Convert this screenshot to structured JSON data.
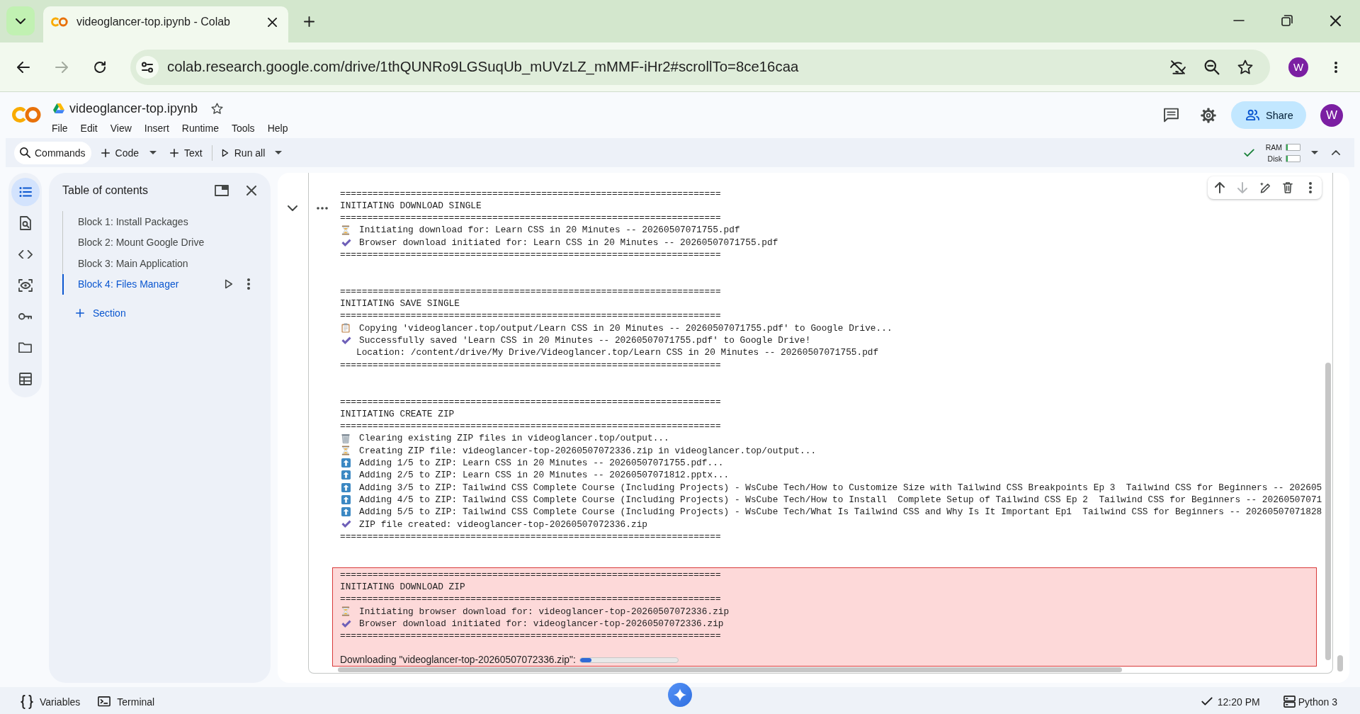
{
  "browser": {
    "tab_title": "videoglancer-top.ipynb - Colab",
    "url": "colab.research.google.com/drive/1thQUNRo9LGSuqUb_mUVzLZ_mMMF-iHr2#scrollTo=8ce16caa",
    "profile_initial": "W"
  },
  "header": {
    "notebook_title": "videoglancer-top.ipynb",
    "menu": [
      "File",
      "Edit",
      "View",
      "Insert",
      "Runtime",
      "Tools",
      "Help"
    ],
    "share_label": "Share",
    "avatar_initial": "W"
  },
  "toolbar": {
    "commands": "Commands",
    "add_code": "Code",
    "add_text": "Text",
    "run_all": "Run all",
    "resources": [
      {
        "label": "RAM",
        "level": 0.08
      },
      {
        "label": "Disk",
        "level": 0.08
      }
    ]
  },
  "sidebar": {
    "items": [
      {
        "kind": "contents",
        "selected": true
      },
      {
        "kind": "find",
        "selected": false
      },
      {
        "kind": "snippets",
        "selected": false
      },
      {
        "kind": "inspect",
        "selected": false
      },
      {
        "kind": "secrets",
        "selected": false
      },
      {
        "kind": "files",
        "selected": false
      },
      {
        "kind": "data",
        "selected": false
      }
    ]
  },
  "table_of_contents": {
    "title": "Table of contents",
    "items": [
      {
        "label": "Block 1: Install Packages",
        "selected": false
      },
      {
        "label": "Block 2: Mount Google Drive",
        "selected": false
      },
      {
        "label": "Block 3: Main Application",
        "selected": false
      },
      {
        "label": "Block 4: Files Manager",
        "selected": true
      }
    ],
    "add_section": "Section"
  },
  "cell": {
    "toolbar": [
      {
        "kind": "move_up",
        "disabled": false
      },
      {
        "kind": "move_down",
        "disabled": true
      },
      {
        "kind": "ai_edit",
        "disabled": false
      },
      {
        "kind": "delete",
        "disabled": false
      },
      {
        "kind": "more",
        "disabled": false
      }
    ],
    "output_blocks": [
      {
        "highlighted": false,
        "lines": [
          {
            "kind": "rule",
            "text": "======================================================================"
          },
          {
            "kind": "heading",
            "text": "INITIATING DOWNLOAD SINGLE"
          },
          {
            "kind": "rule",
            "text": "======================================================================"
          },
          {
            "kind": "wait",
            "text": "Initiating download for: Learn CSS in 20 Minutes -- 20260507071755.pdf"
          },
          {
            "kind": "done",
            "text": "Browser download initiated for: Learn CSS in 20 Minutes -- 20260507071755.pdf"
          },
          {
            "kind": "rule",
            "text": "======================================================================"
          }
        ]
      },
      {
        "highlighted": false,
        "lines": [
          {
            "kind": "rule",
            "text": "======================================================================"
          },
          {
            "kind": "heading",
            "text": "INITIATING SAVE SINGLE"
          },
          {
            "kind": "rule",
            "text": "======================================================================"
          },
          {
            "kind": "copy",
            "text": "Copying 'videoglancer.top/output/Learn CSS in 20 Minutes -- 20260507071755.pdf' to Google Drive..."
          },
          {
            "kind": "done",
            "text": "Successfully saved 'Learn CSS in 20 Minutes -- 20260507071755.pdf' to Google Drive!"
          },
          {
            "kind": "detail",
            "text": "Location: /content/drive/My Drive/Videoglancer.top/Learn CSS in 20 Minutes -- 20260507071755.pdf"
          },
          {
            "kind": "rule",
            "text": "======================================================================"
          }
        ]
      },
      {
        "highlighted": false,
        "lines": [
          {
            "kind": "rule",
            "text": "======================================================================"
          },
          {
            "kind": "heading",
            "text": "INITIATING CREATE ZIP"
          },
          {
            "kind": "rule",
            "text": "======================================================================"
          },
          {
            "kind": "clear",
            "text": "Clearing existing ZIP files in videoglancer.top/output..."
          },
          {
            "kind": "wait",
            "text": "Creating ZIP file: videoglancer-top-20260507072336.zip in videoglancer.top/output..."
          },
          {
            "kind": "add",
            "text": "Adding 1/5 to ZIP: Learn CSS in 20 Minutes -- 20260507071755.pdf..."
          },
          {
            "kind": "add",
            "text": "Adding 2/5 to ZIP: Learn CSS in 20 Minutes -- 20260507071812.pptx..."
          },
          {
            "kind": "add",
            "text": "Adding 3/5 to ZIP: Tailwind CSS Complete Course (Including Projects) - WsCube Tech/How to Customize Size with Tailwind CSS Breakpoints Ep 3  Tailwind CSS for Beginners -- 202605"
          },
          {
            "kind": "add",
            "text": "Adding 4/5 to ZIP: Tailwind CSS Complete Course (Including Projects) - WsCube Tech/How to Install  Complete Setup of Tailwind CSS Ep 2  Tailwind CSS for Beginners -- 20260507071"
          },
          {
            "kind": "add",
            "text": "Adding 5/5 to ZIP: Tailwind CSS Complete Course (Including Projects) - WsCube Tech/What Is Tailwind CSS and Why Is It Important Ep1  Tailwind CSS for Beginners -- 20260507071828"
          },
          {
            "kind": "done",
            "text": "ZIP file created: videoglancer-top-20260507072336.zip"
          },
          {
            "kind": "rule",
            "text": "======================================================================"
          }
        ]
      },
      {
        "highlighted": true,
        "lines": [
          {
            "kind": "rule",
            "text": "======================================================================"
          },
          {
            "kind": "heading",
            "text": "INITIATING DOWNLOAD ZIP"
          },
          {
            "kind": "rule",
            "text": "======================================================================"
          },
          {
            "kind": "wait",
            "text": "Initiating browser download for: videoglancer-top-20260507072336.zip"
          },
          {
            "kind": "done",
            "text": "Browser download initiated for: videoglancer-top-20260507072336.zip"
          },
          {
            "kind": "rule",
            "text": "======================================================================"
          }
        ],
        "download": {
          "label": "Downloading \"videoglancer-top-20260507072336.zip\":",
          "level": 0.12
        }
      }
    ]
  },
  "status_bar": {
    "variables": "Variables",
    "terminal": "Terminal",
    "time": "12:20 PM",
    "runtime": "Python 3"
  }
}
